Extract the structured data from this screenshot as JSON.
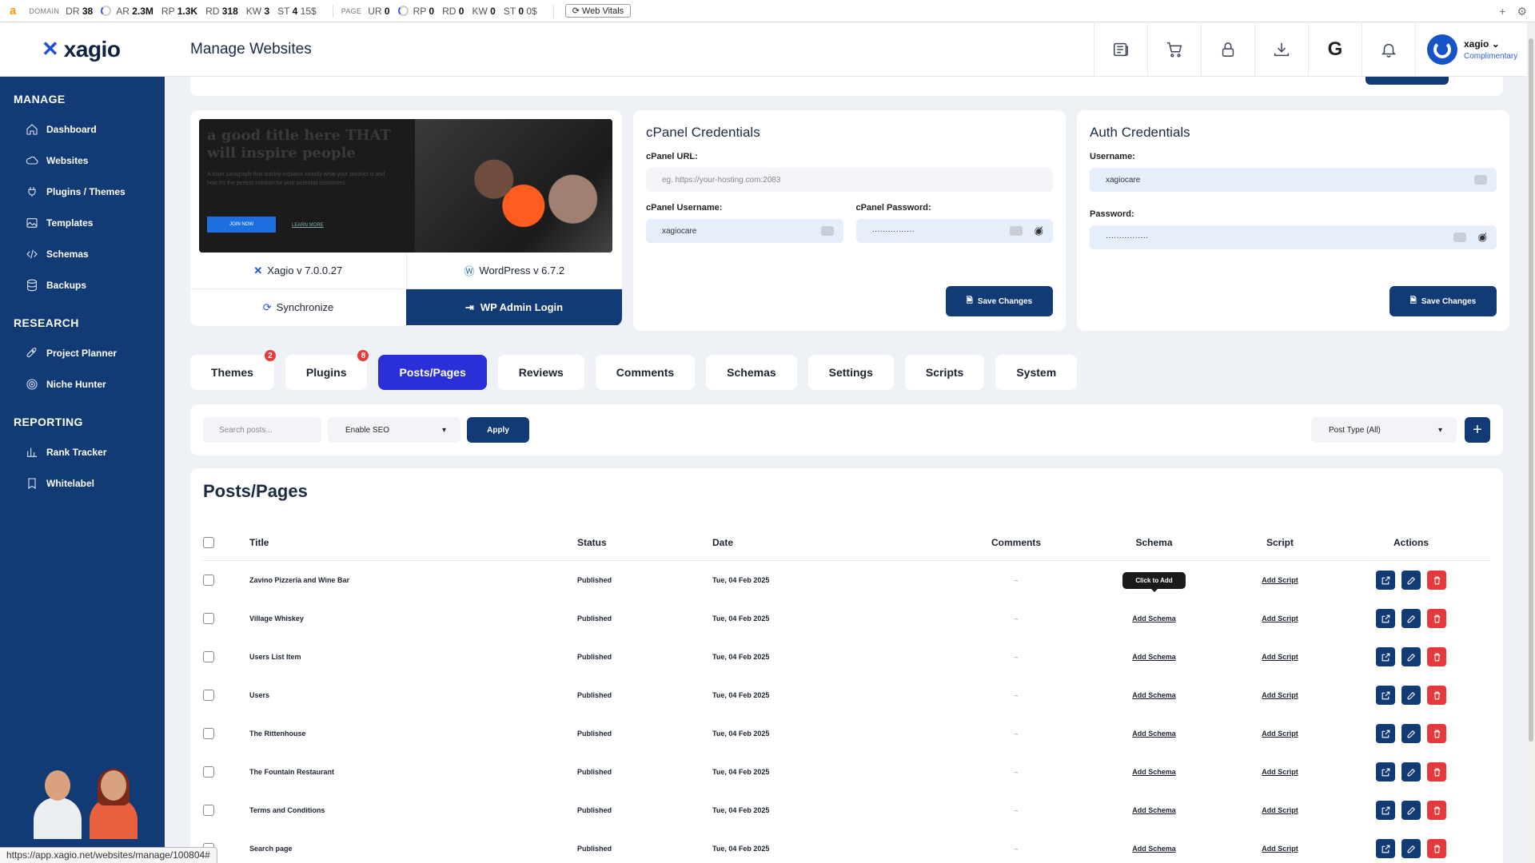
{
  "seobar": {
    "domain_label": "DOMAIN",
    "dr_label": "DR",
    "dr_value": "38",
    "ar_label": "AR",
    "ar_value": "2.3M",
    "rp_label": "RP",
    "rp_value": "1.3K",
    "rd_label": "RD",
    "rd_value": "318",
    "kw_label": "KW",
    "kw_value": "3",
    "st_label": "ST",
    "st_value": "4",
    "st_suffix": "15$",
    "page_label": "PAGE",
    "ur_label": "UR",
    "ur_value": "0",
    "prp_label": "RP",
    "prp_value": "0",
    "prd_label": "RD",
    "prd_value": "0",
    "pkw_label": "KW",
    "pkw_value": "0",
    "pst_label": "ST",
    "pst_value": "0",
    "pst_suffix": "0$",
    "web_vitals": "Web Vitals"
  },
  "header": {
    "brand": "xagio",
    "page_title": "Manage Websites",
    "user_name": "xagio",
    "user_plan": "Complimentary"
  },
  "sidebar": {
    "sections": [
      {
        "title": "MANAGE",
        "items": [
          {
            "label": "Dashboard",
            "icon": "home-icon"
          },
          {
            "label": "Websites",
            "icon": "cloud-icon"
          },
          {
            "label": "Plugins / Themes",
            "icon": "plug-icon"
          },
          {
            "label": "Templates",
            "icon": "image-icon"
          },
          {
            "label": "Schemas",
            "icon": "code-icon"
          },
          {
            "label": "Backups",
            "icon": "database-icon"
          }
        ]
      },
      {
        "title": "RESEARCH",
        "items": [
          {
            "label": "Project Planner",
            "icon": "rocket-icon"
          },
          {
            "label": "Niche Hunter",
            "icon": "target-icon"
          }
        ]
      },
      {
        "title": "REPORTING",
        "items": [
          {
            "label": "Rank Tracker",
            "icon": "bar-chart-icon"
          },
          {
            "label": "Whitelabel",
            "icon": "bookmark-icon"
          }
        ]
      }
    ]
  },
  "site": {
    "versions": {
      "xagio": "Xagio v 7.0.0.27",
      "wordpress": "WordPress v 6.7.2"
    },
    "synchronize": "Synchronize",
    "wp_admin_login": "WP Admin Login"
  },
  "cpanel": {
    "title": "cPanel Credentials",
    "url_label": "cPanel URL:",
    "url_placeholder": "eg. https://your-hosting.com:2083",
    "username_label": "cPanel Username:",
    "username_value": "xagiocare",
    "password_label": "cPanel Password:",
    "password_value": "················",
    "save": "Save Changes"
  },
  "auth": {
    "title": "Auth Credentials",
    "username_label": "Username:",
    "username_value": "xagiocare",
    "password_label": "Password:",
    "password_value": "················",
    "save": "Save Changes"
  },
  "tabs": [
    {
      "label": "Themes",
      "badge": "2"
    },
    {
      "label": "Plugins",
      "badge": "8"
    },
    {
      "label": "Posts/Pages",
      "active": true
    },
    {
      "label": "Reviews"
    },
    {
      "label": "Comments"
    },
    {
      "label": "Schemas"
    },
    {
      "label": "Settings"
    },
    {
      "label": "Scripts"
    },
    {
      "label": "System"
    }
  ],
  "filter": {
    "search_placeholder": "Search posts...",
    "seo_select": "Enable SEO",
    "apply": "Apply",
    "post_type": "Post Type (All)"
  },
  "table": {
    "title": "Posts/Pages",
    "columns": {
      "title": "Title",
      "status": "Status",
      "date": "Date",
      "comments": "Comments",
      "schema": "Schema",
      "script": "Script",
      "actions": "Actions"
    },
    "tooltip": "Click to Add",
    "add_schema": "Add Schema",
    "add_script": "Add Script",
    "rows": [
      {
        "title": "Zavino Pizzeria and Wine Bar",
        "status": "Published",
        "date": "Tue, 04 Feb 2025",
        "comments": "–"
      },
      {
        "title": "Village Whiskey",
        "status": "Published",
        "date": "Tue, 04 Feb 2025",
        "comments": "–"
      },
      {
        "title": "Users List Item",
        "status": "Published",
        "date": "Tue, 04 Feb 2025",
        "comments": "–"
      },
      {
        "title": "Users",
        "status": "Published",
        "date": "Tue, 04 Feb 2025",
        "comments": "–"
      },
      {
        "title": "The Rittenhouse",
        "status": "Published",
        "date": "Tue, 04 Feb 2025",
        "comments": "–"
      },
      {
        "title": "The Fountain Restaurant",
        "status": "Published",
        "date": "Tue, 04 Feb 2025",
        "comments": "–"
      },
      {
        "title": "Terms and Conditions",
        "status": "Published",
        "date": "Tue, 04 Feb 2025",
        "comments": "–"
      },
      {
        "title": "Search page",
        "status": "Published",
        "date": "Tue, 04 Feb 2025",
        "comments": "–"
      }
    ]
  },
  "status_url": "https://app.xagio.net/websites/manage/100804#"
}
